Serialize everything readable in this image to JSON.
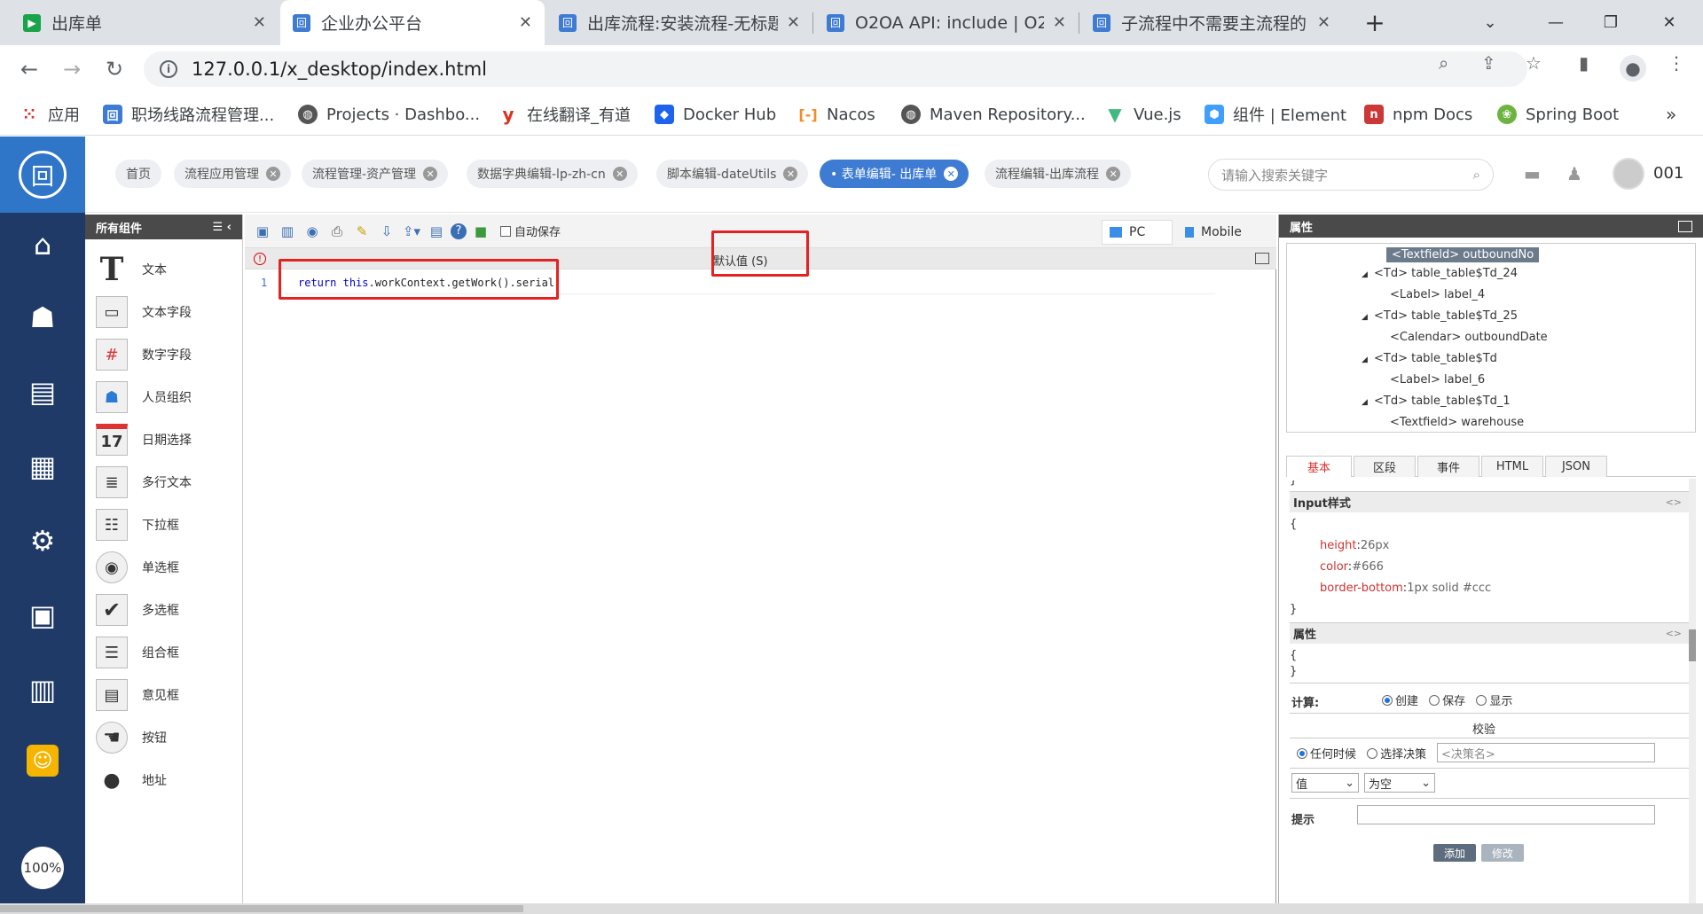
{
  "browser": {
    "tabs": [
      {
        "title": "出库单",
        "fav_color": "#19a34a",
        "fav_glyph": "▶"
      },
      {
        "title": "企业办公平台",
        "fav_color": "#3e7bd3",
        "fav_glyph": "回"
      },
      {
        "title": "出库流程:安装流程-无标题",
        "fav_color": "#3e7bd3",
        "fav_glyph": "回"
      },
      {
        "title": "O2OA API: include | O2",
        "fav_color": "#3e7bd3",
        "fav_glyph": "回"
      },
      {
        "title": "子流程中不需要主流程的",
        "fav_color": "#3e7bd3",
        "fav_glyph": "回"
      }
    ],
    "url": "127.0.0.1/x_desktop/index.html",
    "bookmarks": [
      {
        "label": "应用",
        "icon": "apps-grid-icon",
        "color": "#d93025"
      },
      {
        "label": "职场线路流程管理...",
        "icon": "o2-icon",
        "color": "#3e7bd3"
      },
      {
        "label": "Projects · Dashbo...",
        "icon": "globe-icon",
        "color": "#555555"
      },
      {
        "label": "在线翻译_有道",
        "icon": "youdao-icon",
        "color": "#e0301e"
      },
      {
        "label": "Docker Hub",
        "icon": "docker-icon",
        "color": "#1d63ed"
      },
      {
        "label": "Nacos",
        "icon": "nacos-icon",
        "color": "#f28c28"
      },
      {
        "label": "Maven Repository...",
        "icon": "globe-icon",
        "color": "#555555"
      },
      {
        "label": "Vue.js",
        "icon": "vue-icon",
        "color": "#42b883"
      },
      {
        "label": "组件 | Element",
        "icon": "element-icon",
        "color": "#409eff"
      },
      {
        "label": "npm Docs",
        "icon": "npm-icon",
        "color": "#cb3837"
      },
      {
        "label": "Spring Boot",
        "icon": "spring-icon",
        "color": "#6db33f"
      }
    ]
  },
  "app": {
    "nav_tabs": [
      {
        "label": "首页",
        "closable": false
      },
      {
        "label": "流程应用管理",
        "closable": true
      },
      {
        "label": "流程管理-资产管理",
        "closable": true
      },
      {
        "label": "数据字典编辑-lp-zh-cn",
        "closable": true
      },
      {
        "label": "脚本编辑-dateUtils",
        "closable": true
      },
      {
        "label": "• 表单编辑- 出库单",
        "closable": true,
        "active": true
      },
      {
        "label": "流程编辑-出库流程",
        "closable": true
      }
    ],
    "search_placeholder": "请输入搜索关键字",
    "user": "001",
    "zoom": "100%"
  },
  "components": {
    "title": "所有组件",
    "items": [
      {
        "label": "文本",
        "icon": "text-T-icon"
      },
      {
        "label": "文本字段",
        "icon": "textfield-icon"
      },
      {
        "label": "数字字段",
        "icon": "number-field-icon"
      },
      {
        "label": "人员组织",
        "icon": "org-icon"
      },
      {
        "label": "日期选择",
        "icon": "calendar-icon"
      },
      {
        "label": "多行文本",
        "icon": "textarea-icon"
      },
      {
        "label": "下拉框",
        "icon": "select-icon"
      },
      {
        "label": "单选框",
        "icon": "radio-icon"
      },
      {
        "label": "多选框",
        "icon": "checkbox-icon"
      },
      {
        "label": "组合框",
        "icon": "combobox-icon"
      },
      {
        "label": "意见框",
        "icon": "opinion-icon"
      },
      {
        "label": "按钮",
        "icon": "hand-button-icon"
      },
      {
        "label": "地址",
        "icon": "pin-icon"
      }
    ]
  },
  "editor": {
    "autosave_label": "自动保存",
    "mode_pc": "PC",
    "mode_mobile": "Mobile",
    "script_title": "默认值 (S)",
    "line_number": "1",
    "code_keyword1": "return",
    "code_keyword2": "this",
    "code_rest": ".workContext.getWork().serial;"
  },
  "properties": {
    "title": "属性",
    "tree": [
      {
        "label": "<Textfield> outboundNo",
        "selected": true,
        "indent": 1
      },
      {
        "label": "<Td> table_table$Td_24",
        "indent": 0,
        "arrow": true
      },
      {
        "label": "<Label> label_4",
        "indent": 1
      },
      {
        "label": "<Td> table_table$Td_25",
        "indent": 0,
        "arrow": true
      },
      {
        "label": "<Calendar> outboundDate",
        "indent": 1
      },
      {
        "label": "<Td> table_table$Td",
        "indent": 0,
        "arrow": true
      },
      {
        "label": "<Label> label_6",
        "indent": 1
      },
      {
        "label": "<Td> table_table$Td_1",
        "indent": 0,
        "arrow": true
      },
      {
        "label": "<Textfield> warehouse",
        "indent": 1
      }
    ],
    "tabs": [
      "基本",
      "区段",
      "事件",
      "HTML",
      "JSON"
    ],
    "input_style_title": "Input样式",
    "open_brace": "{",
    "close_brace": "}",
    "style_rules": [
      {
        "key": "height",
        "value": "26px"
      },
      {
        "key": "color",
        "value": "#666"
      },
      {
        "key": "border-bottom",
        "value": "1px solid #ccc"
      }
    ],
    "attr_title": "属性",
    "calc_label": "计算:",
    "calc_options": [
      "创建",
      "保存",
      "显示"
    ],
    "validate_title": "校验",
    "validate_options": [
      "任何时候",
      "选择决策"
    ],
    "decision_placeholder": "<决策名>",
    "value_select": "值",
    "cond_select": "为空",
    "hint_label": "提示",
    "add_btn": "添加",
    "modify_btn": "修改"
  }
}
